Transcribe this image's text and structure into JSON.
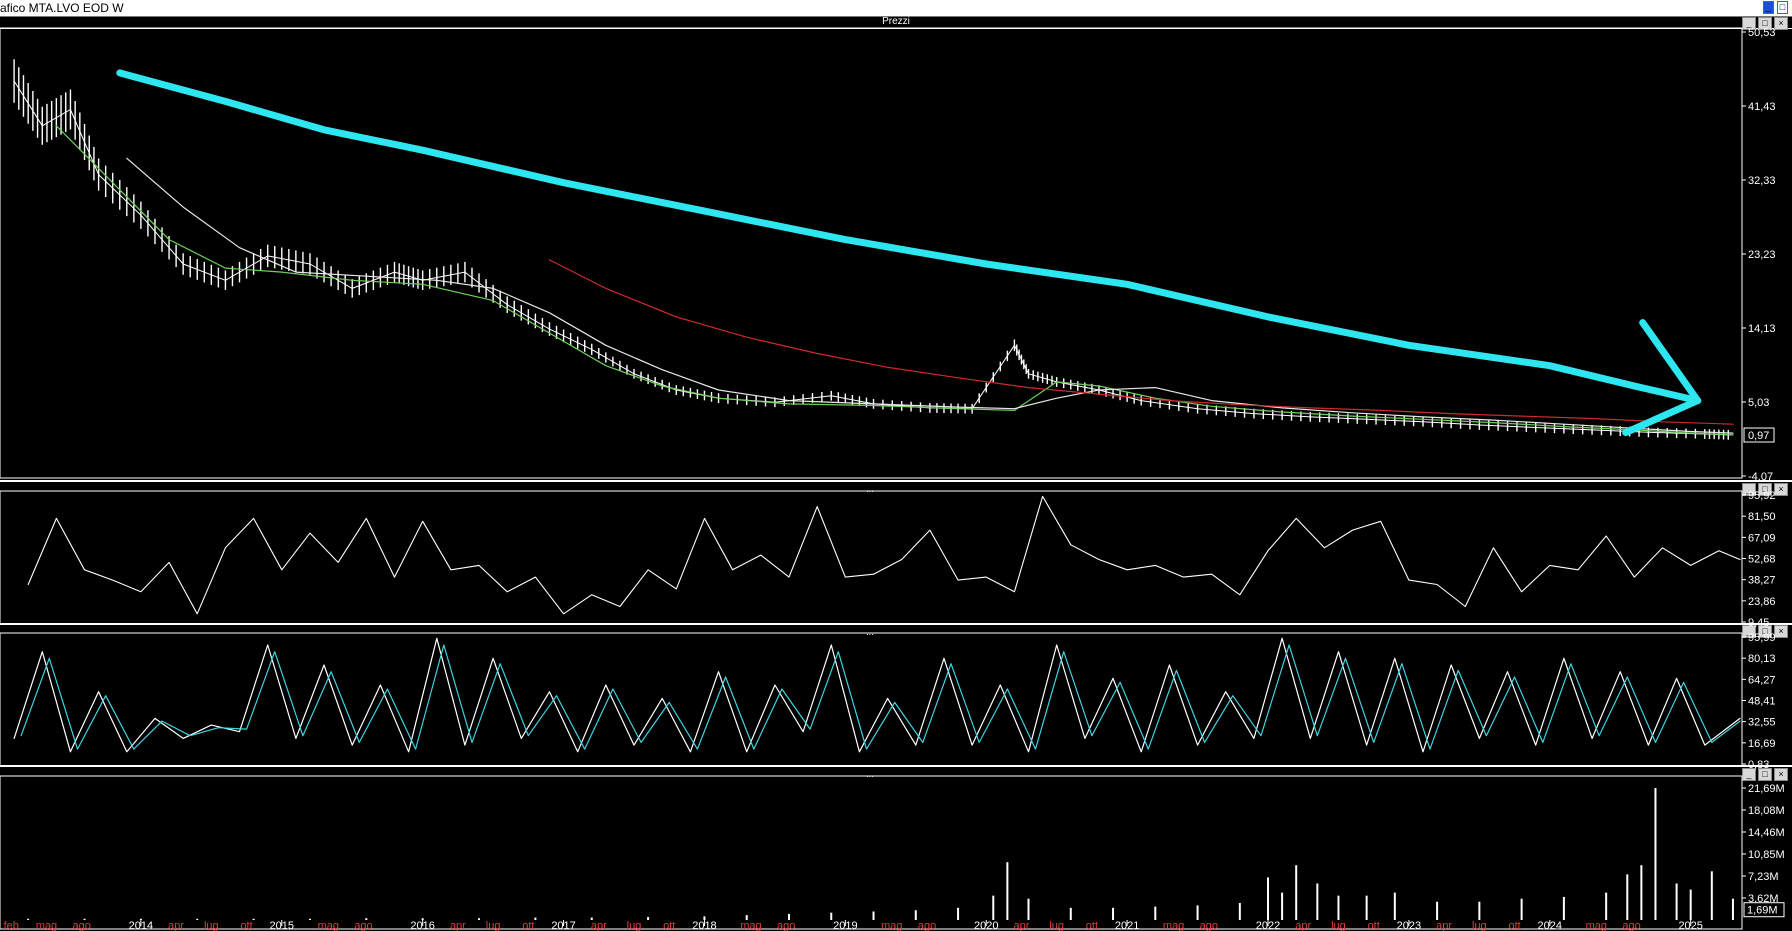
{
  "window": {
    "title": "afico MTA.LVO EOD W",
    "buttons": [
      "_",
      "□",
      "×"
    ]
  },
  "pane_buttons": [
    "_",
    "□",
    "×"
  ],
  "chart_data": [
    {
      "type": "line",
      "title": "Prezzi",
      "yticks": [
        "50,53",
        "41,43",
        "32,33",
        "23,23",
        "14,13",
        "5,03",
        "-4,07"
      ],
      "ylim": [
        -4.07,
        50.53
      ],
      "last_value": "0,97",
      "grid": false,
      "series": [
        {
          "type": "bar-ohlc",
          "color": "#ffffff",
          "x": [
            2013.1,
            2013.3,
            2013.5,
            2013.7,
            2014.0,
            2014.3,
            2014.6,
            2014.9,
            2015.2,
            2015.5,
            2015.8,
            2016.0,
            2016.3,
            2016.6,
            2016.9,
            2017.2,
            2017.5,
            2017.8,
            2018.1,
            2018.5,
            2018.9,
            2019.2,
            2019.6,
            2019.9,
            2020.2,
            2020.3,
            2020.5,
            2020.8,
            2021.1,
            2021.5,
            2021.9,
            2022.3,
            2022.7,
            2023.1,
            2023.5,
            2023.9,
            2024.3,
            2024.7,
            2025.1,
            2025.3
          ],
          "values": [
            44.5,
            39,
            41,
            33,
            28,
            22,
            20,
            23,
            22,
            19,
            21,
            20,
            21,
            17,
            14,
            11.5,
            8.5,
            6.5,
            5.5,
            5,
            5.8,
            4.8,
            4.3,
            4.2,
            12,
            8.5,
            7.5,
            6.5,
            5.2,
            4.2,
            3.6,
            3.2,
            2.9,
            2.6,
            2.2,
            1.9,
            1.6,
            1.3,
            1.1,
            0.97
          ]
        },
        {
          "type": "line",
          "color": "#6fd05b",
          "x": [
            2013.4,
            2013.8,
            2014.2,
            2014.6,
            2015.0,
            2015.5,
            2016.0,
            2016.5,
            2016.9,
            2017.3,
            2017.7,
            2018.1,
            2018.6,
            2019.2,
            2019.8,
            2020.2,
            2020.5,
            2020.8,
            2021.2,
            2021.6,
            2022.1,
            2022.6,
            2023.1,
            2023.6,
            2024.1,
            2024.6,
            2025.0,
            2025.3
          ],
          "values": [
            39,
            32,
            25,
            21.5,
            21,
            20,
            19.5,
            17.5,
            13.5,
            9.5,
            7,
            5.5,
            4.8,
            4.6,
            4.2,
            4.0,
            7.5,
            7.0,
            5.5,
            4.5,
            3.8,
            3.3,
            2.9,
            2.5,
            2.0,
            1.6,
            1.2,
            1.0
          ]
        },
        {
          "type": "line",
          "color": "#e8e8e8",
          "x": [
            2013.9,
            2014.3,
            2014.7,
            2015.1,
            2015.6,
            2016.1,
            2016.5,
            2016.9,
            2017.3,
            2017.7,
            2018.1,
            2018.6,
            2019.2,
            2019.8,
            2020.2,
            2020.5,
            2020.8,
            2021.2,
            2021.6,
            2022.1,
            2022.6,
            2023.1,
            2023.6,
            2024.1,
            2024.6,
            2025.0,
            2025.3
          ],
          "values": [
            35,
            29,
            24,
            21,
            20.5,
            20,
            19,
            16,
            12,
            9,
            6.5,
            5.2,
            4.8,
            4.4,
            4.2,
            5.5,
            6.5,
            6.8,
            5.2,
            4.3,
            3.7,
            3.2,
            2.8,
            2.3,
            1.8,
            1.4,
            1.2
          ]
        },
        {
          "type": "line",
          "color": "#d02a2a",
          "x": [
            2016.9,
            2017.3,
            2017.8,
            2018.3,
            2018.8,
            2019.3,
            2019.8,
            2020.3,
            2020.8,
            2021.3,
            2021.8,
            2022.3,
            2022.8,
            2023.3,
            2023.8,
            2024.3,
            2024.8,
            2025.3
          ],
          "values": [
            22.5,
            19,
            15.5,
            13,
            11,
            9.3,
            8.0,
            6.8,
            6.0,
            5.2,
            4.7,
            4.3,
            4.0,
            3.6,
            3.3,
            3.0,
            2.6,
            2.3
          ]
        }
      ],
      "annotation": {
        "type": "arrow",
        "color": "#2ee6f0",
        "x": [
          2013.85,
          2014.6,
          2015.3,
          2016.0,
          2017.0,
          2018.0,
          2019.0,
          2020.0,
          2021.0,
          2022.0,
          2023.0,
          2024.0,
          2024.6,
          2025.05
        ],
        "values": [
          45.5,
          42,
          38.5,
          36,
          32,
          28.5,
          25,
          22,
          19.5,
          15.5,
          12,
          9.5,
          7.0,
          5.2
        ]
      }
    },
    {
      "type": "line",
      "yticks": [
        "95,92",
        "81,50",
        "67,09",
        "52,68",
        "38,27",
        "23,86",
        "9,45"
      ],
      "ylim": [
        9.45,
        95.92
      ],
      "series": [
        {
          "color": "#ffffff",
          "x": [
            2013.2,
            2013.4,
            2013.6,
            2013.8,
            2014.0,
            2014.2,
            2014.4,
            2014.6,
            2014.8,
            2015.0,
            2015.2,
            2015.4,
            2015.6,
            2015.8,
            2016.0,
            2016.2,
            2016.4,
            2016.6,
            2016.8,
            2017.0,
            2017.2,
            2017.4,
            2017.6,
            2017.8,
            2018.0,
            2018.2,
            2018.4,
            2018.6,
            2018.8,
            2019.0,
            2019.2,
            2019.4,
            2019.6,
            2019.8,
            2020.0,
            2020.2,
            2020.4,
            2020.6,
            2020.8,
            2021.0,
            2021.2,
            2021.4,
            2021.6,
            2021.8,
            2022.0,
            2022.2,
            2022.4,
            2022.6,
            2022.8,
            2023.0,
            2023.2,
            2023.4,
            2023.6,
            2023.8,
            2024.0,
            2024.2,
            2024.4,
            2024.6,
            2024.8,
            2025.0,
            2025.2,
            2025.35
          ],
          "values": [
            35,
            80,
            45,
            38,
            30,
            50,
            15,
            60,
            80,
            45,
            70,
            50,
            80,
            40,
            78,
            45,
            48,
            30,
            40,
            15,
            28,
            20,
            45,
            32,
            80,
            45,
            55,
            40,
            88,
            40,
            42,
            52,
            72,
            38,
            40,
            30,
            95,
            62,
            52,
            45,
            48,
            40,
            42,
            28,
            58,
            80,
            60,
            72,
            78,
            38,
            35,
            20,
            60,
            30,
            48,
            45,
            68,
            40,
            60,
            48,
            58,
            52
          ]
        }
      ]
    },
    {
      "type": "line",
      "yticks": [
        "95,99",
        "80,13",
        "64,27",
        "48,41",
        "32,55",
        "16,69",
        "0,83"
      ],
      "ylim": [
        0.83,
        95.99
      ],
      "series": [
        {
          "color": "#ffffff",
          "x": [
            2013.1,
            2013.3,
            2013.5,
            2013.7,
            2013.9,
            2014.1,
            2014.3,
            2014.5,
            2014.7,
            2014.9,
            2015.1,
            2015.3,
            2015.5,
            2015.7,
            2015.9,
            2016.1,
            2016.3,
            2016.5,
            2016.7,
            2016.9,
            2017.1,
            2017.3,
            2017.5,
            2017.7,
            2017.9,
            2018.1,
            2018.3,
            2018.5,
            2018.7,
            2018.9,
            2019.1,
            2019.3,
            2019.5,
            2019.7,
            2019.9,
            2020.1,
            2020.3,
            2020.5,
            2020.7,
            2020.9,
            2021.1,
            2021.3,
            2021.5,
            2021.7,
            2021.9,
            2022.1,
            2022.3,
            2022.5,
            2022.7,
            2022.9,
            2023.1,
            2023.3,
            2023.5,
            2023.7,
            2023.9,
            2024.1,
            2024.3,
            2024.5,
            2024.7,
            2024.9,
            2025.1,
            2025.35
          ],
          "values": [
            20,
            85,
            10,
            55,
            10,
            35,
            20,
            30,
            25,
            90,
            20,
            75,
            15,
            60,
            10,
            95,
            15,
            80,
            20,
            55,
            10,
            60,
            15,
            50,
            10,
            70,
            10,
            60,
            25,
            90,
            10,
            50,
            15,
            80,
            15,
            60,
            10,
            90,
            20,
            65,
            10,
            75,
            15,
            55,
            20,
            95,
            20,
            85,
            15,
            80,
            10,
            75,
            20,
            70,
            15,
            80,
            20,
            70,
            15,
            65,
            15,
            35
          ]
        },
        {
          "color": "#3fd3e0",
          "x": [
            2013.15,
            2013.35,
            2013.55,
            2013.75,
            2013.95,
            2014.15,
            2014.35,
            2014.55,
            2014.75,
            2014.95,
            2015.15,
            2015.35,
            2015.55,
            2015.75,
            2015.95,
            2016.15,
            2016.35,
            2016.55,
            2016.75,
            2016.95,
            2017.15,
            2017.35,
            2017.55,
            2017.75,
            2017.95,
            2018.15,
            2018.35,
            2018.55,
            2018.75,
            2018.95,
            2019.15,
            2019.35,
            2019.55,
            2019.75,
            2019.95,
            2020.15,
            2020.35,
            2020.55,
            2020.75,
            2020.95,
            2021.15,
            2021.35,
            2021.55,
            2021.75,
            2021.95,
            2022.15,
            2022.35,
            2022.55,
            2022.75,
            2022.95,
            2023.15,
            2023.35,
            2023.55,
            2023.75,
            2023.95,
            2024.15,
            2024.35,
            2024.55,
            2024.75,
            2024.95,
            2025.15,
            2025.35
          ],
          "values": [
            22,
            80,
            12,
            52,
            12,
            33,
            22,
            28,
            27,
            85,
            22,
            70,
            17,
            57,
            12,
            90,
            17,
            76,
            22,
            52,
            12,
            57,
            17,
            47,
            12,
            66,
            12,
            57,
            27,
            85,
            12,
            47,
            17,
            76,
            17,
            57,
            12,
            85,
            22,
            62,
            12,
            71,
            17,
            52,
            22,
            90,
            22,
            80,
            17,
            76,
            12,
            71,
            22,
            66,
            17,
            76,
            22,
            66,
            17,
            62,
            17,
            33
          ]
        }
      ]
    },
    {
      "type": "bar",
      "yticks": [
        "21,69M",
        "18,08M",
        "14,46M",
        "10,85M",
        "7,23M",
        "3,62M"
      ],
      "ylim": [
        0,
        21.69
      ],
      "last_value": "1,69M",
      "series": [
        {
          "color": "#ffffff",
          "x": [
            2013.2,
            2013.6,
            2014.0,
            2014.4,
            2014.8,
            2015.2,
            2015.6,
            2016.0,
            2016.4,
            2016.8,
            2017.2,
            2017.6,
            2018.0,
            2018.3,
            2018.6,
            2018.9,
            2019.2,
            2019.5,
            2019.8,
            2020.05,
            2020.15,
            2020.3,
            2020.6,
            2020.9,
            2021.2,
            2021.5,
            2021.8,
            2022.0,
            2022.1,
            2022.2,
            2022.35,
            2022.5,
            2022.7,
            2022.9,
            2023.2,
            2023.5,
            2023.8,
            2024.1,
            2024.4,
            2024.55,
            2024.65,
            2024.75,
            2024.9,
            2025.0,
            2025.15,
            2025.3
          ],
          "values": [
            0.2,
            0.2,
            0.2,
            0.2,
            0.2,
            0.2,
            0.3,
            0.3,
            0.3,
            0.4,
            0.4,
            0.5,
            0.6,
            0.8,
            1.0,
            1.2,
            1.4,
            1.6,
            2.0,
            4.0,
            9.5,
            3.5,
            2.0,
            2.0,
            2.2,
            2.4,
            2.8,
            7.0,
            4.5,
            9.0,
            6.0,
            4.0,
            4.0,
            4.5,
            3.0,
            3.0,
            3.5,
            3.8,
            4.5,
            7.5,
            9.0,
            21.69,
            6.0,
            5.0,
            8.0,
            3.5
          ]
        }
      ]
    }
  ],
  "x_axis": {
    "years": [
      {
        "label": "2014",
        "x": 2014.0
      },
      {
        "label": "2015",
        "x": 2015.0
      },
      {
        "label": "2016",
        "x": 2016.0
      },
      {
        "label": "2017",
        "x": 2017.0
      },
      {
        "label": "2018",
        "x": 2018.0
      },
      {
        "label": "2019",
        "x": 2019.0
      },
      {
        "label": "2020",
        "x": 2020.0
      },
      {
        "label": "2021",
        "x": 2021.0
      },
      {
        "label": "2022",
        "x": 2022.0
      },
      {
        "label": "2023",
        "x": 2023.0
      },
      {
        "label": "2024",
        "x": 2024.0
      },
      {
        "label": "2025",
        "x": 2025.0
      }
    ],
    "months": [
      {
        "label": "feb",
        "x": 2013.08
      },
      {
        "label": "mag",
        "x": 2013.33
      },
      {
        "label": "ago",
        "x": 2013.58
      },
      {
        "label": "apr",
        "x": 2014.25
      },
      {
        "label": "lug",
        "x": 2014.5
      },
      {
        "label": "ott",
        "x": 2014.75
      },
      {
        "label": "mag",
        "x": 2015.33
      },
      {
        "label": "ago",
        "x": 2015.58
      },
      {
        "label": "apr",
        "x": 2016.25
      },
      {
        "label": "lug",
        "x": 2016.5
      },
      {
        "label": "ott",
        "x": 2016.75
      },
      {
        "label": "apr",
        "x": 2017.25
      },
      {
        "label": "lug",
        "x": 2017.5
      },
      {
        "label": "ott",
        "x": 2017.75
      },
      {
        "label": "mag",
        "x": 2018.33
      },
      {
        "label": "ago",
        "x": 2018.58
      },
      {
        "label": "mag",
        "x": 2019.33
      },
      {
        "label": "ago",
        "x": 2019.58
      },
      {
        "label": "apr",
        "x": 2020.25
      },
      {
        "label": "lug",
        "x": 2020.5
      },
      {
        "label": "ott",
        "x": 2020.75
      },
      {
        "label": "mag",
        "x": 2021.33
      },
      {
        "label": "ago",
        "x": 2021.58
      },
      {
        "label": "apr",
        "x": 2022.25
      },
      {
        "label": "lug",
        "x": 2022.5
      },
      {
        "label": "ott",
        "x": 2022.75
      },
      {
        "label": "apr",
        "x": 2023.25
      },
      {
        "label": "lug",
        "x": 2023.5
      },
      {
        "label": "ott",
        "x": 2023.75
      },
      {
        "label": "mag",
        "x": 2024.33
      },
      {
        "label": "ago",
        "x": 2024.58
      }
    ],
    "xlim": [
      2013.0,
      2025.35
    ],
    "year_color": "#ffffff",
    "month_color": "#e23b3b"
  }
}
